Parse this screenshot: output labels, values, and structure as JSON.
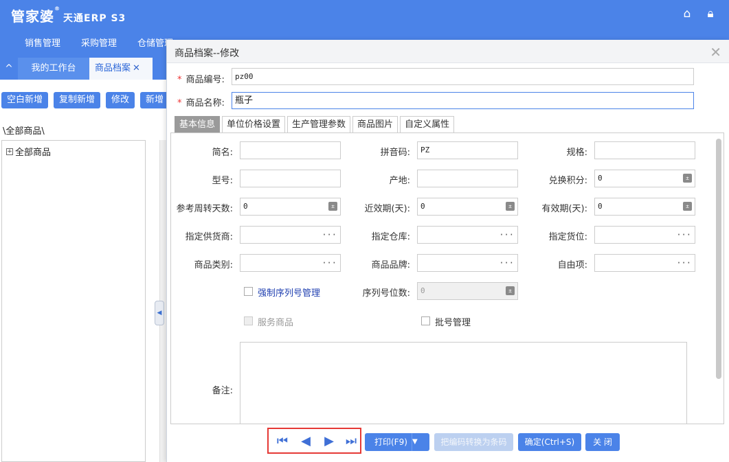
{
  "header": {
    "logo_text": "管家婆",
    "logo_reg": "®",
    "logo_sub": "天通ERP S3",
    "icons": [
      "home-icon",
      "lock-icon"
    ],
    "nav": [
      "销售管理",
      "采购管理",
      "仓储管理"
    ]
  },
  "tabs": {
    "collapse_icon": "^",
    "items": [
      {
        "label": "我的工作台"
      },
      {
        "label": "商品档案",
        "close": "✕"
      }
    ]
  },
  "toolbar": {
    "buttons": [
      "空白新增",
      "复制新增",
      "修改",
      "新增"
    ]
  },
  "tree": {
    "breadcrumb": "\\全部商品\\",
    "root_label": "全部商品",
    "expand_symbol": "+"
  },
  "modal": {
    "title": "商品档案--修改",
    "close": "✕",
    "code_label": "商品编号:",
    "code_value": "pz00",
    "name_label": "商品名称:",
    "name_value": "瓶子",
    "required_mark": "*",
    "tabs": [
      "基本信息",
      "单位价格设置",
      "生产管理参数",
      "商品图片",
      "自定义属性"
    ],
    "active_tab": "基本信息",
    "fields": {
      "short_name": {
        "label": "简名:",
        "value": ""
      },
      "pinyin": {
        "label": "拼音码:",
        "value": "PZ"
      },
      "spec": {
        "label": "规格:",
        "value": ""
      },
      "model": {
        "label": "型号:",
        "value": ""
      },
      "origin": {
        "label": "产地:",
        "value": ""
      },
      "points": {
        "label": "兑换积分:",
        "value": "0"
      },
      "turnover_days": {
        "label": "参考周转天数:",
        "value": "0"
      },
      "near_expiry": {
        "label": "近效期(天):",
        "value": "0"
      },
      "shelf_life": {
        "label": "有效期(天):",
        "value": "0"
      },
      "supplier": {
        "label": "指定供货商:",
        "value": ""
      },
      "warehouse": {
        "label": "指定仓库:",
        "value": ""
      },
      "location": {
        "label": "指定货位:",
        "value": ""
      },
      "category": {
        "label": "商品类别:",
        "value": ""
      },
      "brand": {
        "label": "商品品牌:",
        "value": ""
      },
      "custom": {
        "label": "自由项:",
        "value": ""
      },
      "serial_digits": {
        "label": "序列号位数:",
        "value": "0"
      },
      "remark": {
        "label": "备注:",
        "value": ""
      }
    },
    "checkboxes": {
      "force_serial": {
        "label": "强制序列号管理",
        "checked": false
      },
      "service_goods": {
        "label": "服务商品",
        "checked": false
      },
      "batch": {
        "label": "批号管理",
        "checked": false
      }
    },
    "footer": {
      "print": "打印(F9)",
      "convert": "把编码转换为条码",
      "confirm": "确定(Ctrl+S)",
      "close": "关 闭"
    }
  },
  "colors": {
    "brand_blue": "#4b83e8",
    "highlight_red": "#e53935",
    "required_red": "#ee3333"
  }
}
